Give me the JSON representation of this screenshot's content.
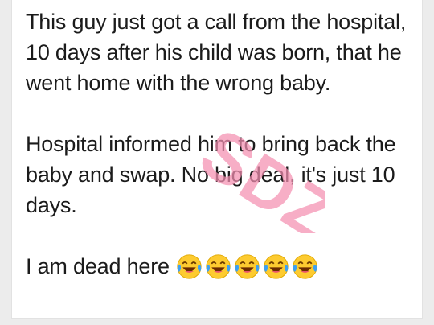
{
  "post": {
    "paragraph_1": "This guy just got a call from the hospital, 10 days after his child was born, that he went home with the wrong baby.",
    "paragraph_2": "Hospital informed him to bring back the baby and swap. No big deal, it's just 10 days.",
    "paragraph_3": "I am dead here",
    "emoji_count": 5,
    "emoji": "face-with-tears-of-joy"
  },
  "watermark": {
    "text": "SDZ",
    "color": "#f48fb1"
  }
}
